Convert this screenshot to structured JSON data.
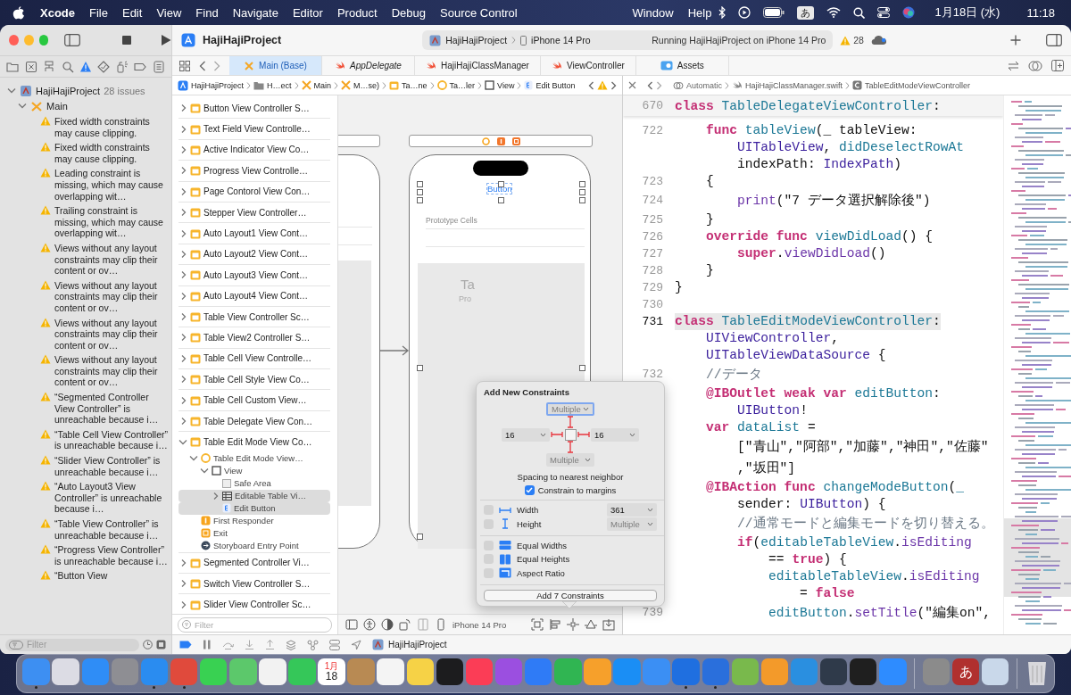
{
  "menubar": {
    "app": "Xcode",
    "menus": [
      "File",
      "Edit",
      "View",
      "Find",
      "Navigate",
      "Editor",
      "Product",
      "Debug",
      "Source Control"
    ],
    "menus_after_notch": [
      "Window",
      "Help"
    ],
    "input_mode": "あ",
    "date": "1月18日 (水)",
    "time": "11:18"
  },
  "toolbar": {
    "project": "HajiHajiProject",
    "scheme": "HajiHajiProject",
    "device": "iPhone 14 Pro",
    "status": "Running HajiHajiProject on iPhone 14 Pro",
    "warnings": "28"
  },
  "navigator": {
    "tabs": [
      {
        "kind": "files",
        "selected": false
      },
      {
        "kind": "source_control",
        "selected": false
      },
      {
        "kind": "symbols",
        "selected": false
      },
      {
        "kind": "find",
        "selected": false
      },
      {
        "kind": "issues",
        "selected": true
      },
      {
        "kind": "tests",
        "selected": false
      },
      {
        "kind": "debug",
        "selected": false
      },
      {
        "kind": "breakpoints",
        "selected": false
      },
      {
        "kind": "reports",
        "selected": false
      }
    ],
    "tree": {
      "label": "HajiHajiProject",
      "note": "28 issues",
      "expanded": true,
      "children": [
        {
          "label": "Main",
          "expanded": true,
          "children": [
            {
              "label": "Fixed width constraints may cause clipping."
            },
            {
              "label": "Fixed width constraints may cause clipping."
            },
            {
              "label": "Leading constraint is missing, which may cause overlapping wit…"
            },
            {
              "label": "Trailing constraint is missing, which may cause overlapping wit…"
            },
            {
              "label": "Views without any layout constraints may clip their content or ov…"
            },
            {
              "label": "Views without any layout constraints may clip their content or ov…"
            },
            {
              "label": "Views without any layout constraints may clip their content or ov…"
            },
            {
              "label": "Views without any layout constraints may clip their content or ov…"
            },
            {
              "label": "“Segmented Controller View Controller” is unreachable because i…"
            },
            {
              "label": "“Table Cell View Controller” is unreachable because i…"
            },
            {
              "label": "“Slider View Controller” is unreachable because i…"
            },
            {
              "label": "“Auto Layout3 View Controller” is unreachable because i…"
            },
            {
              "label": "“Table View Controller” is unreachable because i…"
            },
            {
              "label": "“Progress View Controller” is unreachable because i…"
            },
            {
              "label": "“Button View"
            }
          ]
        }
      ]
    },
    "filter_placeholder": "Filter"
  },
  "editor_tabs": [
    {
      "label": "Main (Base)",
      "kind": "storyboard",
      "selected": true,
      "preview": false
    },
    {
      "label": "AppDelegate",
      "kind": "swift",
      "selected": false,
      "preview": true
    },
    {
      "label": "HajiHajiClassManager",
      "kind": "swift",
      "selected": false,
      "preview": false
    },
    {
      "label": "ViewController",
      "kind": "swift",
      "selected": false,
      "preview": false
    },
    {
      "label": "Assets",
      "kind": "assets",
      "selected": false,
      "preview": false
    }
  ],
  "ib_jumpbar": [
    {
      "label": "HajiHajiProject",
      "kind": "project"
    },
    {
      "label": "H…ect",
      "kind": "folder"
    },
    {
      "label": "Main",
      "kind": "storyboard"
    },
    {
      "label": "M…se)",
      "kind": "storyboard"
    },
    {
      "label": "Ta…ne",
      "kind": "scene"
    },
    {
      "label": "Ta…ler",
      "kind": "controller"
    },
    {
      "label": "View",
      "kind": "view"
    },
    {
      "label": "Edit Button",
      "kind": "button"
    }
  ],
  "outline": [
    {
      "label": "Button View Controller S…",
      "kind": "scene",
      "expanded": false,
      "selected": false
    },
    {
      "label": "Text Field View Controlle…",
      "kind": "scene",
      "expanded": false,
      "selected": false
    },
    {
      "label": "Active Indicator View Co…",
      "kind": "scene",
      "expanded": false,
      "selected": false
    },
    {
      "label": "Progress View Controlle…",
      "kind": "scene",
      "expanded": false,
      "selected": false
    },
    {
      "label": "Page Contorol View Con…",
      "kind": "scene",
      "expanded": false,
      "selected": false
    },
    {
      "label": "Stepper View Controller…",
      "kind": "scene",
      "expanded": false,
      "selected": false
    },
    {
      "label": "Auto Layout1 View Cont…",
      "kind": "scene",
      "expanded": false,
      "selected": false
    },
    {
      "label": "Auto Layout2 View Cont…",
      "kind": "scene",
      "expanded": false,
      "selected": false
    },
    {
      "label": "Auto Layout3 View Cont…",
      "kind": "scene",
      "expanded": false,
      "selected": false
    },
    {
      "label": "Auto Layout4 View Cont…",
      "kind": "scene",
      "expanded": false,
      "selected": false
    },
    {
      "label": "Table View Controller Sc…",
      "kind": "scene",
      "expanded": false,
      "selected": false
    },
    {
      "label": "Table View2 Controller S…",
      "kind": "scene",
      "expanded": false,
      "selected": false
    },
    {
      "label": "Table Cell View Controlle…",
      "kind": "scene",
      "expanded": false,
      "selected": false
    },
    {
      "label": "Table Cell Style View Co…",
      "kind": "scene",
      "expanded": false,
      "selected": false
    },
    {
      "label": "Table Cell Custom View…",
      "kind": "scene",
      "expanded": false,
      "selected": false
    },
    {
      "label": "Table Delegate View Con…",
      "kind": "scene",
      "expanded": false,
      "selected": false
    },
    {
      "label": "Table Edit Mode View Co…",
      "kind": "scene",
      "expanded": true,
      "selected": false,
      "children": [
        {
          "label": "Table Edit Mode View…",
          "kind": "controller",
          "expanded": true,
          "selected": false,
          "children": [
            {
              "label": "View",
              "kind": "view",
              "expanded": true,
              "selected": false,
              "children": [
                {
                  "label": "Safe Area",
                  "kind": "safe_area",
                  "selected": false
                },
                {
                  "label": "Editable Table Vi…",
                  "kind": "table",
                  "expanded": false,
                  "selected": true
                },
                {
                  "label": "Edit Button",
                  "kind": "button",
                  "selected": true
                }
              ]
            }
          ]
        },
        {
          "label": "First Responder",
          "kind": "first_responder",
          "selected": false
        },
        {
          "label": "Exit",
          "kind": "exit",
          "selected": false
        },
        {
          "label": "Storyboard Entry Point",
          "kind": "entry",
          "selected": false
        }
      ]
    },
    {
      "label": "Segmented Controller Vi…",
      "kind": "scene",
      "expanded": false,
      "selected": false
    },
    {
      "label": "Switch View Controller S…",
      "kind": "scene",
      "expanded": false,
      "selected": false
    },
    {
      "label": "Slider View Controller Sc…",
      "kind": "scene",
      "expanded": false,
      "selected": false
    }
  ],
  "outline_filter_placeholder": "Filter",
  "canvas": {
    "button_label": "Button",
    "button_selected": true,
    "prototype_label": "Prototype Cells",
    "table_title": "Ta",
    "table_subtitle": "Pro"
  },
  "ib_bottom": {
    "device": "iPhone 14 Pro"
  },
  "popover": {
    "title": "Add New Constraints",
    "spacing": [
      {
        "kind": "top",
        "placeholder": "Multiple",
        "focused": true,
        "pinned": true
      },
      {
        "kind": "left",
        "value": "16",
        "focused": false,
        "pinned": true
      },
      {
        "kind": "right",
        "value": "16",
        "focused": false,
        "pinned": true
      },
      {
        "kind": "bottom",
        "placeholder": "Multiple",
        "focused": false,
        "pinned": true
      }
    ],
    "spacing_label": "Spacing to nearest neighbor",
    "margins": {
      "label": "Constrain to margins",
      "checked": true
    },
    "options": [
      {
        "kind": "width",
        "label": "Width",
        "checked": false,
        "value": "361"
      },
      {
        "kind": "height",
        "label": "Height",
        "checked": false,
        "placeholder": "Multiple"
      },
      {
        "kind": "equal_widths",
        "label": "Equal Widths",
        "checked": false
      },
      {
        "kind": "equal_heights",
        "label": "Equal Heights",
        "checked": false
      },
      {
        "kind": "aspect_ratio",
        "label": "Aspect Ratio",
        "checked": false
      }
    ],
    "button": "Add 7 Constraints"
  },
  "code_jumpbar": {
    "mode": "Automatic",
    "file": "HajiHajiClassManager.swift",
    "symbol": "TableEditModeViewController"
  },
  "code": {
    "sticky": {
      "number": "670",
      "tokens": [
        {
          "kind": "kw",
          "t": "class"
        },
        {
          "kind": "decl",
          "t": " TableDelegateViewController"
        },
        {
          "kind": "p",
          "t": ":"
        }
      ]
    },
    "lines": [
      {
        "number": "722",
        "current": false,
        "rows": [
          {
            "tokens": [
              {
                "kind": "kw",
                "t": "    func"
              },
              {
                "kind": "decl",
                "t": " tableView"
              },
              {
                "kind": "p",
                "t": "(_ tableView:"
              }
            ]
          },
          {
            "tokens": [
              {
                "kind": "type",
                "t": "        UITableView"
              },
              {
                "kind": "p",
                "t": ", "
              },
              {
                "kind": "decl",
                "t": "didDeselectRowAt"
              }
            ]
          },
          {
            "tokens": [
              {
                "kind": "p",
                "t": "        indexPath: "
              },
              {
                "kind": "type",
                "t": "IndexPath"
              },
              {
                "kind": "p",
                "t": ")"
              }
            ]
          }
        ]
      },
      {
        "number": "723",
        "current": false,
        "rows": [
          {
            "tokens": [
              {
                "kind": "p",
                "t": "    {"
              }
            ]
          }
        ]
      },
      {
        "number": "724",
        "current": false,
        "rows": [
          {
            "tokens": [
              {
                "kind": "call",
                "t": "        print"
              },
              {
                "kind": "p",
                "t": "(\"7 データ選択解除後\")"
              }
            ]
          }
        ]
      },
      {
        "number": "725",
        "current": false,
        "rows": [
          {
            "tokens": [
              {
                "kind": "p",
                "t": "    }"
              }
            ]
          }
        ]
      },
      {
        "number": "726",
        "current": false,
        "rows": [
          {
            "tokens": [
              {
                "kind": "kw",
                "t": "    override func"
              },
              {
                "kind": "decl",
                "t": " viewDidLoad"
              },
              {
                "kind": "p",
                "t": "() {"
              }
            ]
          }
        ]
      },
      {
        "number": "727",
        "current": false,
        "rows": [
          {
            "tokens": [
              {
                "kind": "kw",
                "t": "        super"
              },
              {
                "kind": "p",
                "t": "."
              },
              {
                "kind": "call",
                "t": "viewDidLoad"
              },
              {
                "kind": "p",
                "t": "()"
              }
            ]
          }
        ]
      },
      {
        "number": "728",
        "current": false,
        "rows": [
          {
            "tokens": [
              {
                "kind": "p",
                "t": "    }"
              }
            ]
          }
        ]
      },
      {
        "number": "729",
        "current": false,
        "rows": [
          {
            "tokens": [
              {
                "kind": "p",
                "t": "}"
              }
            ]
          }
        ]
      },
      {
        "number": "730",
        "current": false
      },
      {
        "number": "731",
        "current": true,
        "rows": [
          {
            "tokens": [
              {
                "kind": "kw",
                "t": "class"
              },
              {
                "kind": "decl",
                "t": " TableEditModeViewController"
              },
              {
                "kind": "p",
                "t": ":"
              }
            ]
          },
          {
            "tokens": [
              {
                "kind": "type",
                "t": "    UIViewController"
              },
              {
                "kind": "p",
                "t": ","
              }
            ]
          },
          {
            "tokens": [
              {
                "kind": "type",
                "t": "    UITableViewDataSource"
              },
              {
                "kind": "p",
                "t": " {"
              }
            ]
          }
        ]
      },
      {
        "number": "732",
        "current": false,
        "rows": [
          {
            "tokens": [
              {
                "kind": "cm",
                "t": "    //データ"
              }
            ]
          }
        ]
      },
      {
        "current": false,
        "rows": [
          {
            "tokens": [
              {
                "kind": "kw",
                "t": "    @IBOutlet weak var"
              },
              {
                "kind": "decl",
                "t": " editButton"
              },
              {
                "kind": "p",
                "t": ":"
              }
            ]
          },
          {
            "tokens": [
              {
                "kind": "type",
                "t": "        UIButton"
              },
              {
                "kind": "p",
                "t": "!"
              }
            ]
          }
        ]
      },
      {
        "current": false,
        "rows": [
          {
            "tokens": [
              {
                "kind": "kw",
                "t": "    var"
              },
              {
                "kind": "decl",
                "t": " dataList"
              },
              {
                "kind": "p",
                "t": " ="
              }
            ]
          },
          {
            "tokens": [
              {
                "kind": "p",
                "t": "        [\"青山\",\"阿部\",\"加藤\",\"神田\",\"佐藤\""
              }
            ]
          },
          {
            "tokens": [
              {
                "kind": "p",
                "t": "        ,\"坂田\"]"
              }
            ]
          }
        ]
      },
      {
        "current": false,
        "rows": [
          {
            "tokens": [
              {
                "kind": "kw",
                "t": "    @IBAction func"
              },
              {
                "kind": "decl",
                "t": " changeModeButton"
              },
              {
                "kind": "p",
                "t": "("
              },
              {
                "kind": "decl",
                "t": "_"
              }
            ]
          },
          {
            "tokens": [
              {
                "kind": "p",
                "t": "        sender: "
              },
              {
                "kind": "type",
                "t": "UIButton"
              },
              {
                "kind": "p",
                "t": ") {"
              }
            ]
          }
        ]
      },
      {
        "current": false,
        "rows": [
          {
            "tokens": [
              {
                "kind": "cm",
                "t": "        //通常モードと編集モードを切り替える。"
              }
            ]
          }
        ]
      },
      {
        "current": false,
        "rows": [
          {
            "tokens": [
              {
                "kind": "kw",
                "t": "        if"
              },
              {
                "kind": "p",
                "t": "("
              },
              {
                "kind": "decl",
                "t": "editableTableView"
              },
              {
                "kind": "p",
                "t": "."
              },
              {
                "kind": "call",
                "t": "isEditing"
              }
            ]
          },
          {
            "tokens": [
              {
                "kind": "p",
                "t": "            == "
              },
              {
                "kind": "kw",
                "t": "true"
              },
              {
                "kind": "p",
                "t": ") {"
              }
            ]
          }
        ]
      },
      {
        "current": false,
        "rows": [
          {
            "tokens": [
              {
                "kind": "decl",
                "t": "            editableTableView"
              },
              {
                "kind": "p",
                "t": "."
              },
              {
                "kind": "call",
                "t": "isEditing"
              }
            ]
          },
          {
            "tokens": [
              {
                "kind": "p",
                "t": "                = "
              },
              {
                "kind": "kw",
                "t": "false"
              }
            ]
          }
        ]
      },
      {
        "number": "739",
        "current": false,
        "rows": [
          {
            "tokens": [
              {
                "kind": "decl",
                "t": "            editButton"
              },
              {
                "kind": "p",
                "t": "."
              },
              {
                "kind": "call",
                "t": "setTitle"
              },
              {
                "kind": "p",
                "t": "(\"編集on\","
              }
            ]
          }
        ]
      }
    ]
  },
  "debug_bar": {
    "target": "HajiHajiProject"
  },
  "dock": [
    {
      "kind": "app",
      "color": "#3d8ff2",
      "running": true
    },
    {
      "kind": "app",
      "color": "#dcdce4",
      "running": false
    },
    {
      "kind": "app",
      "color": "#2f8df6",
      "running": false
    },
    {
      "kind": "app",
      "color": "#8e8e93",
      "running": false
    },
    {
      "kind": "app",
      "color": "#2a8cf0",
      "running": true
    },
    {
      "kind": "app",
      "color": "#e04a3c",
      "running": true
    },
    {
      "kind": "app",
      "color": "#39d152",
      "running": false
    },
    {
      "kind": "app",
      "color": "#5cc86b",
      "running": false
    },
    {
      "kind": "app",
      "color": "#f2f2f2",
      "running": false
    },
    {
      "kind": "app",
      "color": "#35c759",
      "running": false
    },
    {
      "kind": "calendar",
      "color": "#ffffff",
      "running": false,
      "month": "1月",
      "label": "18"
    },
    {
      "kind": "app",
      "color": "#b88a53",
      "running": false
    },
    {
      "kind": "app",
      "color": "#f4f4f4",
      "running": false
    },
    {
      "kind": "app",
      "color": "#f6d246",
      "running": false
    },
    {
      "kind": "app",
      "color": "#1c1c1e",
      "running": false
    },
    {
      "kind": "app",
      "color": "#fb3d56",
      "running": false
    },
    {
      "kind": "app",
      "color": "#9b4fe0",
      "running": false
    },
    {
      "kind": "app",
      "color": "#2f7bf6",
      "running": false
    },
    {
      "kind": "app",
      "color": "#30b552",
      "running": false
    },
    {
      "kind": "app",
      "color": "#f6a02b",
      "running": false
    },
    {
      "kind": "app",
      "color": "#1a8ef5",
      "running": false
    },
    {
      "kind": "app",
      "color": "#3b8ff4",
      "running": false
    },
    {
      "kind": "app",
      "color": "#1f6fe0",
      "running": true
    },
    {
      "kind": "app",
      "color": "#2a6fdc",
      "running": true
    },
    {
      "kind": "app",
      "color": "#79b94c",
      "running": false
    },
    {
      "kind": "app",
      "color": "#f39a2a",
      "running": false
    },
    {
      "kind": "app",
      "color": "#2a8fe0",
      "running": false
    },
    {
      "kind": "app",
      "color": "#2f3a4a",
      "running": false
    },
    {
      "kind": "app",
      "color": "#1f1f1f",
      "running": false
    },
    {
      "kind": "app",
      "color": "#2e8cff",
      "running": false
    },
    {
      "kind": "separator"
    },
    {
      "kind": "app",
      "color": "#8b8b8b",
      "running": false
    },
    {
      "kind": "glyph",
      "color": "#b0302f",
      "running": false,
      "label": "あ"
    },
    {
      "kind": "app",
      "color": "#c9d8ea",
      "running": false
    },
    {
      "kind": "separator"
    },
    {
      "kind": "trash",
      "color": "#d8d8dc",
      "running": false
    }
  ]
}
